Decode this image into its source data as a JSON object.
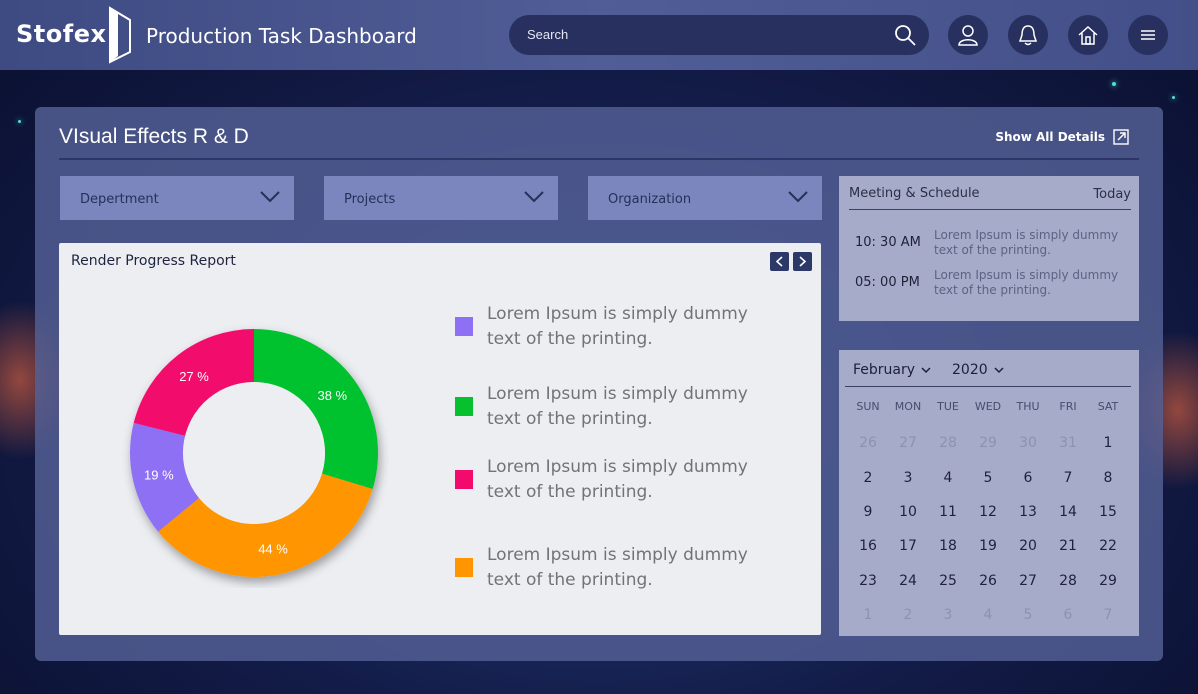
{
  "brand": {
    "name": "Stofex"
  },
  "header": {
    "title": "Production Task Dashboard",
    "search_placeholder": "Search",
    "icons": [
      "search-icon",
      "user-icon",
      "bell-icon",
      "home-icon",
      "menu-icon"
    ]
  },
  "panel": {
    "title": "VIsual Effects R & D",
    "show_details": "Show All Details",
    "filters": [
      "Depertment",
      "Projects",
      "Organization"
    ]
  },
  "chart": {
    "title": "Render Progress Report",
    "legend": [
      {
        "text": "Lorem Ipsum is simply dummy text of the printing.",
        "color": "#8e70f4"
      },
      {
        "text": "Lorem Ipsum is simply dummy text of the printing.",
        "color": "#06c12d"
      },
      {
        "text": "Lorem Ipsum is simply dummy text of the printing.",
        "color": "#f20a6c"
      },
      {
        "text": "Lorem Ipsum is simply dummy text of the printing.",
        "color": "#ff9500"
      }
    ]
  },
  "chart_data": {
    "type": "pie",
    "title": "Render Progress Report",
    "categories": [
      "",
      "",
      "",
      ""
    ],
    "values": [
      38,
      44,
      19,
      27
    ],
    "labels": [
      "38 %",
      "44 %",
      "19 %",
      "27 %"
    ],
    "colors": [
      "#06c12d",
      "#ff9500",
      "#8e70f4",
      "#f20a6c"
    ],
    "donut": true
  },
  "meetings": {
    "title": "Meeting & Schedule",
    "today": "Today",
    "items": [
      {
        "time": "10: 30 AM",
        "desc": "Lorem Ipsum is simply dummy text of the printing."
      },
      {
        "time": "05: 00 PM",
        "desc": "Lorem Ipsum is simply dummy text of the printing."
      }
    ]
  },
  "calendar": {
    "month": "February",
    "year": "2020",
    "days_of_week": [
      "SUN",
      "MON",
      "TUE",
      "WED",
      "THU",
      "FRI",
      "SAT"
    ],
    "weeks": [
      [
        [
          "26",
          true
        ],
        [
          "27",
          true
        ],
        [
          "28",
          true
        ],
        [
          "29",
          true
        ],
        [
          "30",
          true
        ],
        [
          "31",
          true
        ],
        [
          "1",
          false
        ]
      ],
      [
        [
          "2",
          false
        ],
        [
          "3",
          false
        ],
        [
          "4",
          false
        ],
        [
          "5",
          false
        ],
        [
          "6",
          false
        ],
        [
          "7",
          false
        ],
        [
          "8",
          false
        ]
      ],
      [
        [
          "9",
          false
        ],
        [
          "10",
          false
        ],
        [
          "11",
          false
        ],
        [
          "12",
          false
        ],
        [
          "13",
          false
        ],
        [
          "14",
          false
        ],
        [
          "15",
          false
        ]
      ],
      [
        [
          "16",
          false
        ],
        [
          "17",
          false
        ],
        [
          "18",
          false
        ],
        [
          "19",
          false
        ],
        [
          "20",
          false
        ],
        [
          "21",
          false
        ],
        [
          "22",
          false
        ]
      ],
      [
        [
          "23",
          false
        ],
        [
          "24",
          false
        ],
        [
          "25",
          false
        ],
        [
          "26",
          false
        ],
        [
          "27",
          false
        ],
        [
          "28",
          false
        ],
        [
          "29",
          false
        ]
      ],
      [
        [
          "1",
          true
        ],
        [
          "2",
          true
        ],
        [
          "3",
          true
        ],
        [
          "4",
          true
        ],
        [
          "5",
          true
        ],
        [
          "6",
          true
        ],
        [
          "7",
          true
        ]
      ]
    ]
  }
}
